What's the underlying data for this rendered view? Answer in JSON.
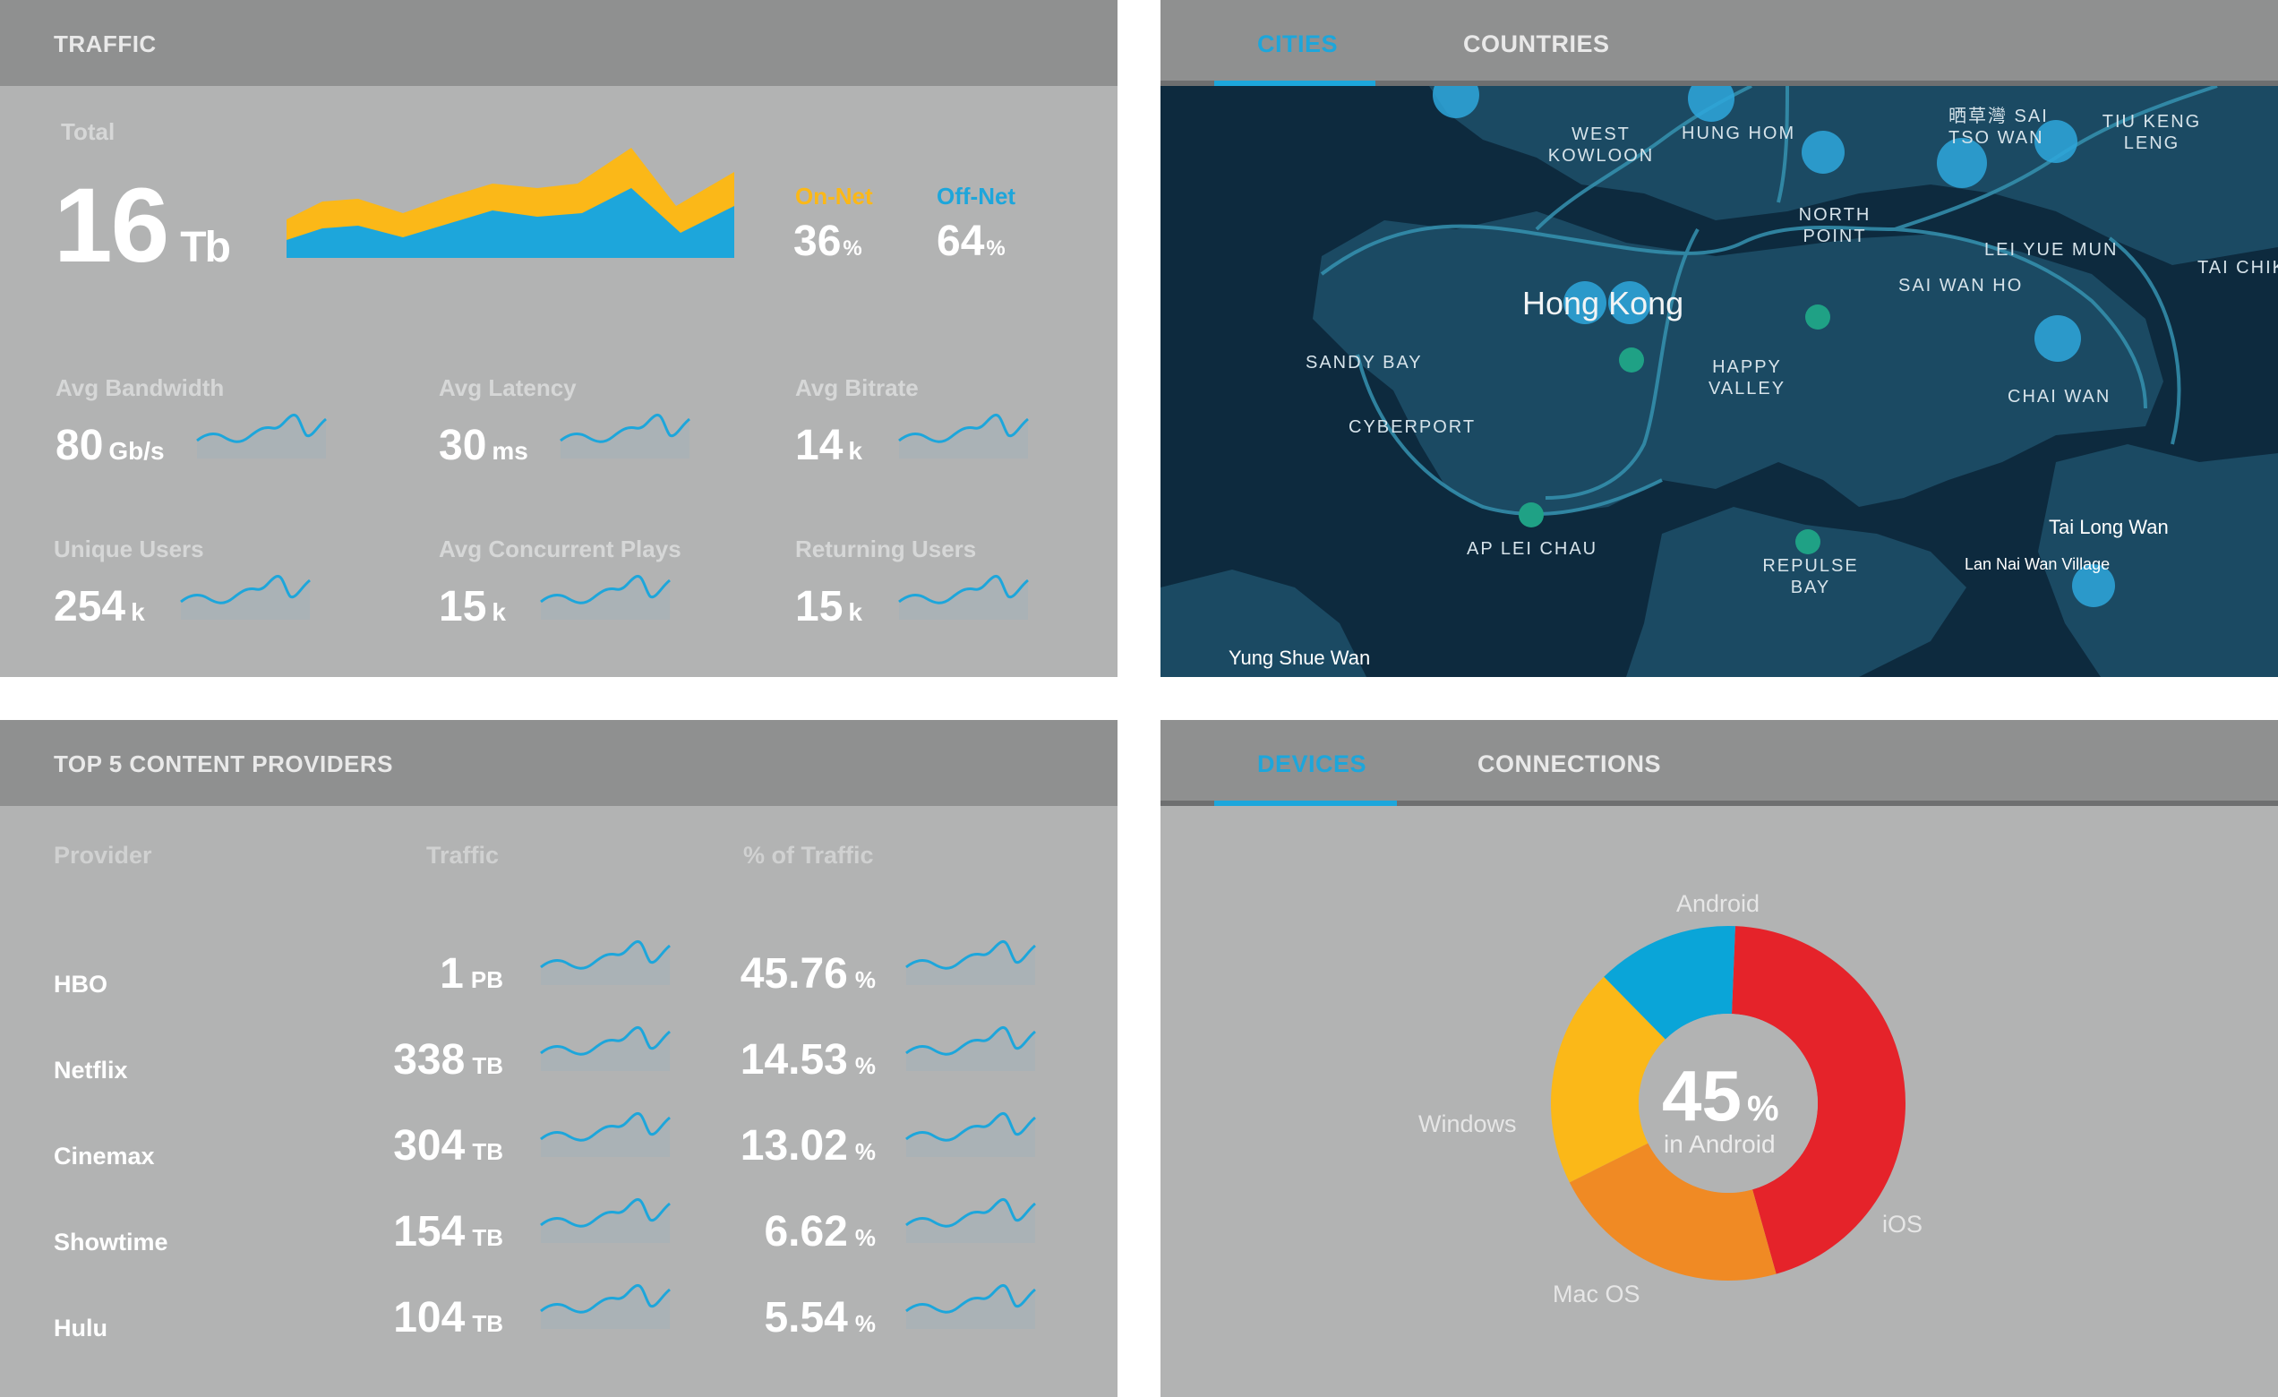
{
  "traffic": {
    "header": "TRAFFIC",
    "total_label": "Total",
    "total_value": "16",
    "total_unit": "Tb",
    "on_net_label": "On-Net",
    "on_net_value": "36",
    "on_net_unit": "%",
    "off_net_label": "Off-Net",
    "off_net_value": "64",
    "off_net_unit": "%",
    "on_net_color": "#fbb818",
    "off_net_color": "#1da6db",
    "stats": [
      {
        "label": "Avg Bandwidth",
        "value": "80",
        "unit": "Gb/s"
      },
      {
        "label": "Avg Latency",
        "value": "30",
        "unit": "ms"
      },
      {
        "label": "Avg Bitrate",
        "value": "14",
        "unit": "k"
      },
      {
        "label": "Unique Users",
        "value": "254",
        "unit": "k"
      },
      {
        "label": "Avg Concurrent Plays",
        "value": "15",
        "unit": "k"
      },
      {
        "label": "Returning Users",
        "value": "15",
        "unit": "k"
      }
    ]
  },
  "map": {
    "tabs": [
      {
        "label": "CITIES",
        "active": true
      },
      {
        "label": "COUNTRIES",
        "active": false
      }
    ],
    "labels": {
      "west_kowloon": "WEST KOWLOON",
      "hung_hom": "HUNG HOM",
      "sai_tso_wan": "晒草灣 SAI TSO WAN",
      "tiu_keng_leng": "TIU KENG LENG",
      "north_point": "NORTH POINT",
      "lei_yue_mun": "LEI YUE MUN",
      "tai_chik": "TAI CHIK",
      "sai_wan_ho": "SAI WAN HO",
      "hong_kong": "Hong Kong",
      "sandy_bay": "SANDY BAY",
      "happy_valley": "HAPPY VALLEY",
      "chai_wan": "CHAI WAN",
      "cyberport": "CYBERPORT",
      "tai_long_wan": "Tai Long Wan",
      "ap_lei_chau": "AP LEI CHAU",
      "repulse_bay": "REPULSE BAY",
      "lan_nai_wan": "Lan Nai Wan Village",
      "yung_shue_wan": "Yung Shue Wan"
    }
  },
  "providers": {
    "header": "TOP 5 CONTENT PROVIDERS",
    "columns": {
      "provider": "Provider",
      "traffic": "Traffic",
      "percent": "% of Traffic"
    },
    "rows": [
      {
        "name": "HBO",
        "traffic": "1",
        "traffic_unit": "PB",
        "percent": "45.76",
        "percent_unit": "%"
      },
      {
        "name": "Netflix",
        "traffic": "338",
        "traffic_unit": "TB",
        "percent": "14.53",
        "percent_unit": "%"
      },
      {
        "name": "Cinemax",
        "traffic": "304",
        "traffic_unit": "TB",
        "percent": "13.02",
        "percent_unit": "%"
      },
      {
        "name": "Showtime",
        "traffic": "154",
        "traffic_unit": "TB",
        "percent": "6.62",
        "percent_unit": "%"
      },
      {
        "name": "Hulu",
        "traffic": "104",
        "traffic_unit": "TB",
        "percent": "5.54",
        "percent_unit": "%"
      }
    ]
  },
  "devices": {
    "tabs": [
      {
        "label": "DEVICES",
        "active": true
      },
      {
        "label": "CONNECTIONS",
        "active": false
      }
    ],
    "center_value": "45",
    "center_unit": "%",
    "center_caption": "in Android"
  },
  "chart_data": {
    "type": "pie",
    "categories": [
      "Android",
      "iOS",
      "Mac OS",
      "Windows"
    ],
    "values": [
      45,
      22,
      20,
      13
    ],
    "colors": [
      "#e5232a",
      "#f08a24",
      "#fbb818",
      "#0aa5d8"
    ]
  }
}
